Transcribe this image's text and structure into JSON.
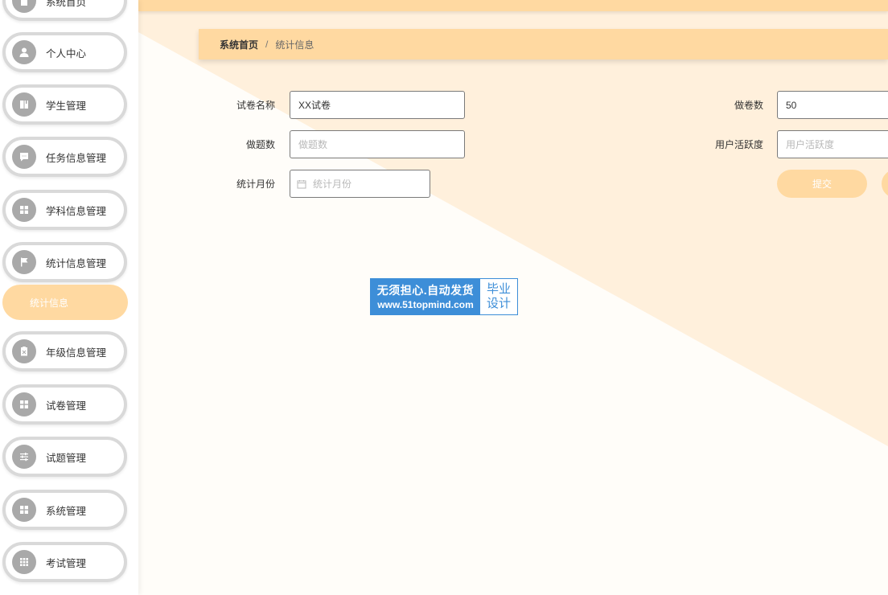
{
  "sidebar": {
    "items": [
      {
        "label": "系统首页",
        "icon": "home-icon"
      },
      {
        "label": "个人中心",
        "icon": "user-icon"
      },
      {
        "label": "学生管理",
        "icon": "book-icon"
      },
      {
        "label": "任务信息管理",
        "icon": "message-icon"
      },
      {
        "label": "学科信息管理",
        "icon": "grid-icon"
      },
      {
        "label": "统计信息管理",
        "icon": "flag-icon"
      },
      {
        "label": "年级信息管理",
        "icon": "clipboard-icon"
      },
      {
        "label": "试卷管理",
        "icon": "grid-icon"
      },
      {
        "label": "试题管理",
        "icon": "sliders-icon"
      },
      {
        "label": "系统管理",
        "icon": "grid-icon"
      },
      {
        "label": "考试管理",
        "icon": "apps-icon"
      }
    ],
    "active_submenu": "统计信息"
  },
  "breadcrumb": {
    "home": "系统首页",
    "separator": "/",
    "current": "统计信息"
  },
  "form": {
    "paper_name": {
      "label": "试卷名称",
      "value": "XX试卷",
      "placeholder": "试卷名称"
    },
    "papers_done": {
      "label": "做卷数",
      "value": "50",
      "placeholder": "做卷数"
    },
    "questions_done": {
      "label": "做题数",
      "value": "",
      "placeholder": "做题数"
    },
    "user_activity": {
      "label": "用户活跃度",
      "value": "",
      "placeholder": "用户活跃度"
    },
    "stat_month": {
      "label": "统计月份",
      "value": "",
      "placeholder": "统计月份"
    },
    "submit_label": "提交"
  },
  "watermark": {
    "line1": "无须担心.自动发货",
    "line2": "www.51topmind.com",
    "right1": "毕业",
    "right2": "设计"
  },
  "colors": {
    "accent": "#ffd9a1",
    "background_light": "#fff0dc",
    "menu_border": "#d9d9d9",
    "icon_bg": "#a9a9a9",
    "stamp_blue": "#3d8ed8"
  }
}
